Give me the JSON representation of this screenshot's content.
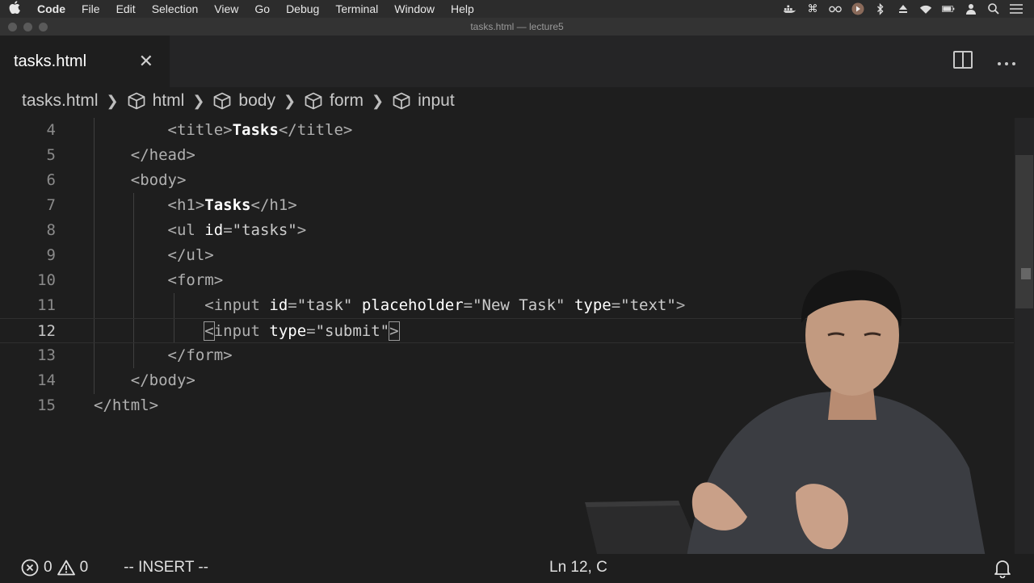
{
  "menubar": {
    "app": "Code",
    "items": [
      "File",
      "Edit",
      "Selection",
      "View",
      "Go",
      "Debug",
      "Terminal",
      "Window",
      "Help"
    ],
    "tray_icons": [
      "docker-icon",
      "command-icon",
      "glasses-icon",
      "media-icon",
      "bluetooth-icon",
      "eject-icon",
      "wifi-icon",
      "battery-icon",
      "user-icon",
      "search-icon",
      "list-icon"
    ]
  },
  "window": {
    "title": "tasks.html — lecture5"
  },
  "tab": {
    "label": "tasks.html",
    "close_glyph": "✕"
  },
  "breadcrumbs": {
    "file": "tasks.html",
    "items": [
      "html",
      "body",
      "form",
      "input"
    ]
  },
  "editor": {
    "current_line": 12,
    "lines": [
      {
        "num": "4",
        "text": "        <title>Tasks</title>"
      },
      {
        "num": "5",
        "text": "    </head>"
      },
      {
        "num": "6",
        "text": "    <body>"
      },
      {
        "num": "7",
        "text": "        <h1>Tasks</h1>"
      },
      {
        "num": "8",
        "text": "        <ul id=\"tasks\">"
      },
      {
        "num": "9",
        "text": "        </ul>"
      },
      {
        "num": "10",
        "text": "        <form>"
      },
      {
        "num": "11",
        "text": "            <input id=\"task\" placeholder=\"New Task\" type=\"text\">"
      },
      {
        "num": "12",
        "text": "            <input type=\"submit\">"
      },
      {
        "num": "13",
        "text": "        </form>"
      },
      {
        "num": "14",
        "text": "    </body>"
      },
      {
        "num": "15",
        "text": "</html>"
      }
    ]
  },
  "statusbar": {
    "errors": "0",
    "warnings": "0",
    "mode": "-- INSERT --",
    "cursor_position": "Ln 12, C"
  }
}
